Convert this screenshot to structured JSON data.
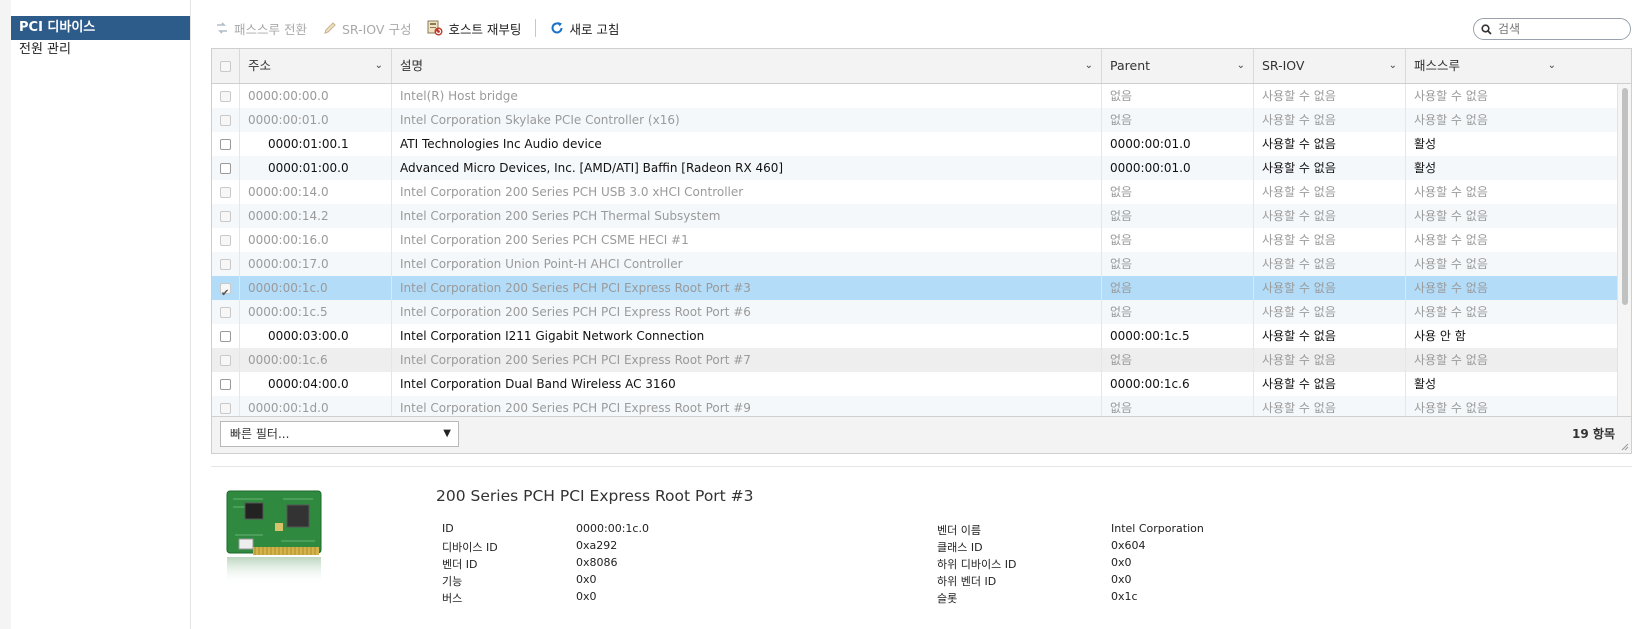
{
  "nav": {
    "items": [
      {
        "label": "PCI 디바이스",
        "active": true
      },
      {
        "label": "전원 관리",
        "active": false
      }
    ]
  },
  "toolbar": {
    "passthrough_label": "패스스루 전환",
    "sriov_label": "SR-IOV 구성",
    "reboot_label": "호스트 재부팅",
    "refresh_label": "새로 고침"
  },
  "search": {
    "placeholder": "검색"
  },
  "table": {
    "columns": [
      "주소",
      "설명",
      "Parent",
      "SR-IOV",
      "패스스루"
    ],
    "rows": [
      {
        "address": "0000:00:00.0",
        "description": "Intel(R) Host bridge",
        "parent": "없음",
        "sriov": "사용할 수 없음",
        "passthrough": "사용할 수 없음",
        "child": false,
        "enabled": false,
        "checked": false
      },
      {
        "address": "0000:00:01.0",
        "description": "Intel Corporation Skylake PCIe Controller (x16)",
        "parent": "없음",
        "sriov": "사용할 수 없음",
        "passthrough": "사용할 수 없음",
        "child": false,
        "enabled": false,
        "checked": false
      },
      {
        "address": "0000:01:00.1",
        "description": "ATI Technologies Inc Audio device",
        "parent": "0000:00:01.0",
        "sriov": "사용할 수 없음",
        "passthrough": "활성",
        "child": true,
        "enabled": true,
        "checked": false
      },
      {
        "address": "0000:01:00.0",
        "description": "Advanced Micro Devices, Inc. [AMD/ATI] Baffin [Radeon RX 460]",
        "parent": "0000:00:01.0",
        "sriov": "사용할 수 없음",
        "passthrough": "활성",
        "child": true,
        "enabled": true,
        "checked": false
      },
      {
        "address": "0000:00:14.0",
        "description": "Intel Corporation 200 Series PCH USB 3.0 xHCI Controller",
        "parent": "없음",
        "sriov": "사용할 수 없음",
        "passthrough": "사용할 수 없음",
        "child": false,
        "enabled": false,
        "checked": false
      },
      {
        "address": "0000:00:14.2",
        "description": "Intel Corporation 200 Series PCH Thermal Subsystem",
        "parent": "없음",
        "sriov": "사용할 수 없음",
        "passthrough": "사용할 수 없음",
        "child": false,
        "enabled": false,
        "checked": false
      },
      {
        "address": "0000:00:16.0",
        "description": "Intel Corporation 200 Series PCH CSME HECI #1",
        "parent": "없음",
        "sriov": "사용할 수 없음",
        "passthrough": "사용할 수 없음",
        "child": false,
        "enabled": false,
        "checked": false
      },
      {
        "address": "0000:00:17.0",
        "description": "Intel Corporation Union Point-H AHCI Controller",
        "parent": "없음",
        "sriov": "사용할 수 없음",
        "passthrough": "사용할 수 없음",
        "child": false,
        "enabled": false,
        "checked": false
      },
      {
        "address": "0000:00:1c.0",
        "description": "Intel Corporation 200 Series PCH PCI Express Root Port #3",
        "parent": "없음",
        "sriov": "사용할 수 없음",
        "passthrough": "사용할 수 없음",
        "child": false,
        "enabled": false,
        "checked": true,
        "selected": true
      },
      {
        "address": "0000:00:1c.5",
        "description": "Intel Corporation 200 Series PCH PCI Express Root Port #6",
        "parent": "없음",
        "sriov": "사용할 수 없음",
        "passthrough": "사용할 수 없음",
        "child": false,
        "enabled": false,
        "checked": false
      },
      {
        "address": "0000:03:00.0",
        "description": "Intel Corporation I211 Gigabit Network Connection",
        "parent": "0000:00:1c.5",
        "sriov": "사용할 수 없음",
        "passthrough": "사용 안 함",
        "child": true,
        "enabled": true,
        "checked": false
      },
      {
        "address": "0000:00:1c.6",
        "description": "Intel Corporation 200 Series PCH PCI Express Root Port #7",
        "parent": "없음",
        "sriov": "사용할 수 없음",
        "passthrough": "사용할 수 없음",
        "child": false,
        "enabled": false,
        "checked": false,
        "hover": true
      },
      {
        "address": "0000:04:00.0",
        "description": "Intel Corporation Dual Band Wireless AC 3160",
        "parent": "0000:00:1c.6",
        "sriov": "사용할 수 없음",
        "passthrough": "활성",
        "child": true,
        "enabled": true,
        "checked": false
      },
      {
        "address": "0000:00:1d.0",
        "description": "Intel Corporation 200 Series PCH PCI Express Root Port #9",
        "parent": "없음",
        "sriov": "사용할 수 없음",
        "passthrough": "사용할 수 없음",
        "child": false,
        "enabled": false,
        "checked": false
      }
    ],
    "quick_filter": "빠른 필터...",
    "count_label": "19 항목"
  },
  "detail": {
    "title": "200 Series PCH PCI Express Root Port #3",
    "left": [
      {
        "label": "ID",
        "value": "0000:00:1c.0"
      },
      {
        "label": "디바이스 ID",
        "value": "0xa292"
      },
      {
        "label": "벤더 ID",
        "value": "0x8086"
      },
      {
        "label": "기능",
        "value": "0x0"
      },
      {
        "label": "버스",
        "value": "0x0"
      }
    ],
    "right": [
      {
        "label": "벤더 이름",
        "value": "Intel Corporation"
      },
      {
        "label": "클래스 ID",
        "value": "0x604"
      },
      {
        "label": "하위 디바이스 ID",
        "value": "0x0"
      },
      {
        "label": "하위 벤더 ID",
        "value": "0x0"
      },
      {
        "label": "슬롯",
        "value": "0x1c"
      }
    ]
  },
  "colors": {
    "nav_active": "#2d5b8a",
    "row_selected": "#b3dcf8",
    "row_alt": "#f5f8fb",
    "refresh_icon": "#1a73c9"
  },
  "icons": [
    "passthrough-icon",
    "pencil-icon",
    "reboot-icon",
    "refresh-icon",
    "search-icon",
    "chevron-down-icon",
    "pci-card-icon"
  ]
}
